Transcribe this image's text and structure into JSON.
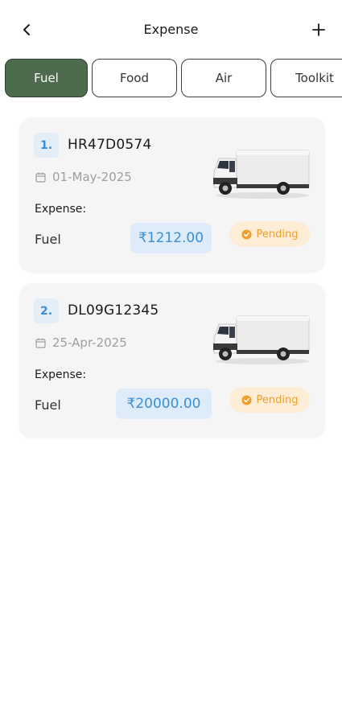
{
  "header": {
    "title": "Expense",
    "back_icon": "chevron-left-icon",
    "add_icon": "plus-icon"
  },
  "tabs": [
    {
      "label": "Fuel",
      "active": true
    },
    {
      "label": "Food",
      "active": false
    },
    {
      "label": "Air",
      "active": false
    },
    {
      "label": "Toolkit",
      "active": false
    }
  ],
  "expenses": [
    {
      "index": "1.",
      "vehicle_no": "HR47D0574",
      "date": "01-May-2025",
      "expense_label": "Expense:",
      "expense_type": "Fuel",
      "amount": "₹1212.00",
      "status": "Pending"
    },
    {
      "index": "2.",
      "vehicle_no": "DL09G12345",
      "date": "25-Apr-2025",
      "expense_label": "Expense:",
      "expense_type": "Fuel",
      "amount": "₹20000.00",
      "status": "Pending"
    }
  ],
  "colors": {
    "active_tab": "#4d6b4d",
    "accent_blue": "#3a8fd6",
    "pending_orange": "#f0a02a",
    "pending_bg": "#fdecd6",
    "card_bg": "#f5f5f5"
  }
}
